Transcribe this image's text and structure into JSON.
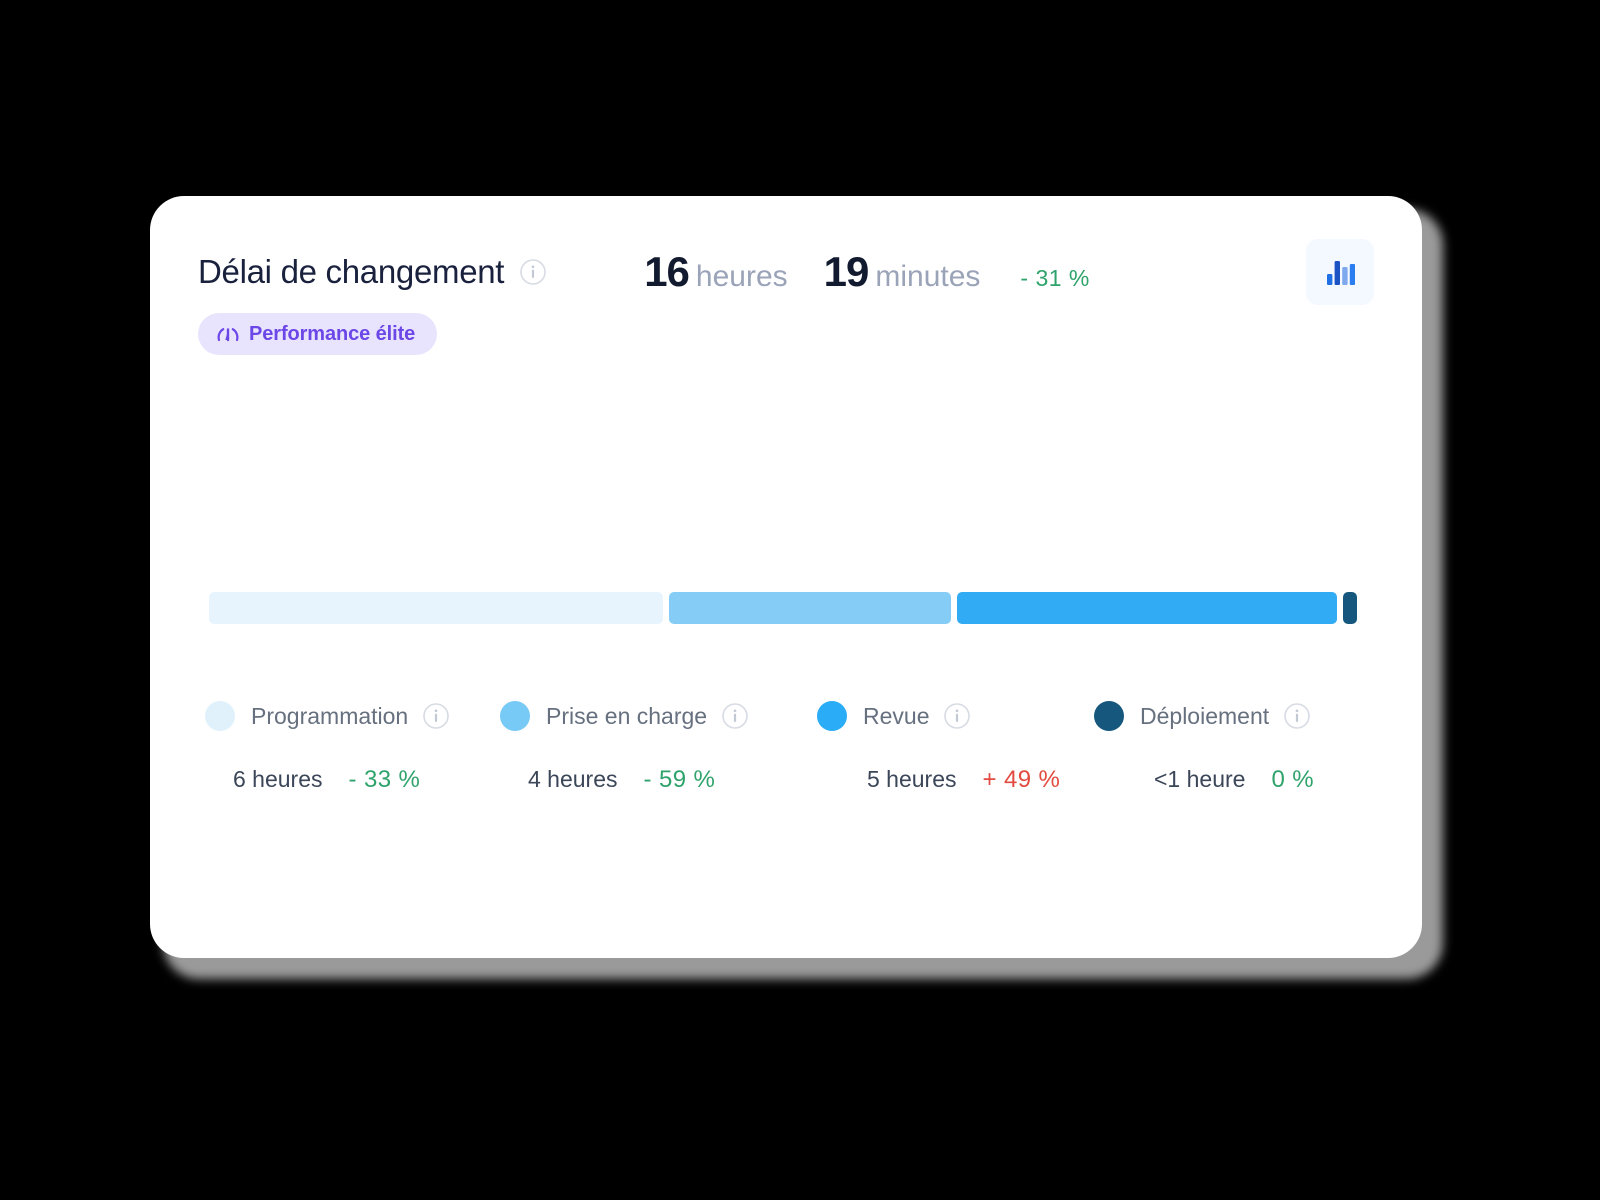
{
  "card": {
    "title": "Délai de changement",
    "title_info_icon": "info-icon",
    "badge": {
      "icon": "gauge-icon",
      "label": "Performance élite"
    },
    "metric": {
      "hours_value": "16",
      "hours_unit": "heures",
      "minutes_value": "19",
      "minutes_unit": "minutes",
      "delta": "- 31 %",
      "delta_color": "#2fa36b"
    },
    "chart_button": {
      "icon": "bar-chart-icon",
      "bg": "#f4f8ff",
      "accent": "#1f6fe5"
    }
  },
  "chart_data": {
    "type": "bar",
    "title": "Délai de changement",
    "subtitle": "16 heures 19 minutes",
    "orientation": "horizontal-stacked",
    "xlabel": "",
    "ylabel": "",
    "categories": [
      "Programmation",
      "Prise en charge",
      "Revue",
      "Déploiement"
    ],
    "values": [
      6,
      4,
      5,
      0.5
    ],
    "value_labels": [
      "6 heures",
      "4 heures",
      "5 heures",
      "<1 heure"
    ],
    "deltas": [
      "- 33 %",
      "- 59 %",
      "+ 49 %",
      "0 %"
    ],
    "delta_directions": [
      "down",
      "down",
      "up",
      "flat"
    ],
    "colors": [
      "#e7f4fd",
      "#85cdf6",
      "#32abf5",
      "#16577e"
    ],
    "segment_widths_pct": [
      39.4,
      24.5,
      33.0,
      1.2
    ],
    "unit": "heures",
    "total_label": "16 heures 19 minutes",
    "total_delta": "- 31 %",
    "legend": [
      "Programmation",
      "Prise en charge",
      "Revue",
      "Déploiement"
    ],
    "legend_position": "bottom",
    "grid": false
  },
  "legend_items": [
    {
      "label": "Programmation",
      "color": "#e0f1fc",
      "time": "6 heures",
      "delta": "- 33 %",
      "direction": "down",
      "info_icon": "info-icon",
      "dot_icon": "legend-dot-icon"
    },
    {
      "label": "Prise en charge",
      "color": "#77c9f6",
      "time": "4 heures",
      "delta": "- 59 %",
      "direction": "down",
      "info_icon": "info-icon",
      "dot_icon": "legend-dot-icon"
    },
    {
      "label": "Revue",
      "color": "#2bacf7",
      "time": "5 heures",
      "delta": "+ 49 %",
      "direction": "up",
      "info_icon": "info-icon",
      "dot_icon": "legend-dot-icon"
    },
    {
      "label": "Déploiement",
      "color": "#16577e",
      "time": "<1 heure",
      "delta": "0 %",
      "direction": "flat",
      "info_icon": "info-icon",
      "dot_icon": "legend-dot-icon"
    }
  ]
}
